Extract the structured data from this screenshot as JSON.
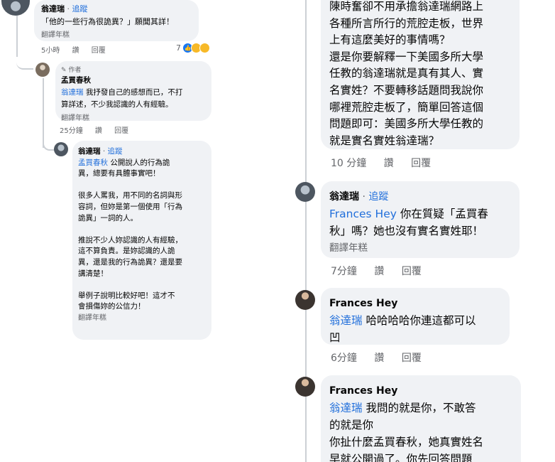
{
  "left": {
    "c1": {
      "author": "翁達瑞",
      "sep": "·",
      "follow": "追蹤",
      "text": "「他的一些行為很詭異？」願聞其詳！",
      "translate": "翻譯年糕",
      "time": "5小時",
      "like": "讚",
      "reply": "回覆",
      "reaction_count": "7",
      "reactions": [
        "like-icon",
        "haha-icon",
        "wow-icon"
      ]
    },
    "c2": {
      "author_badge": "作者",
      "author": "孟買春秋",
      "mention": "翁達瑞",
      "lines": [
        " 我抒發自己的感想而已，不打",
        "算詳述，不少我認識的人有經驗。"
      ],
      "translate": "翻譯年糕",
      "time": "25分鐘",
      "like": "讚",
      "reply": "回覆"
    },
    "c3": {
      "author": "翁達瑞",
      "sep": "·",
      "follow": "追蹤",
      "mention": "孟買春秋",
      "lines": [
        " 公開說人的行為詭",
        "異，總要有具體事實吧！",
        "",
        "很多人罵我，用不同的名詞與形",
        "容詞，但妳是第一個使用「行為",
        "詭異」一詞的人。",
        "",
        "推說不少人妳認識的人有經驗，",
        "這不算負責。是妳認識的人詭",
        "異，還是我的行為詭異？還是要",
        "講清楚！",
        "",
        "舉例子說明比較好吧！這才不",
        "會損傷妳的公信力！"
      ],
      "translate": "翻譯年糕"
    }
  },
  "right": {
    "r0": {
      "lines": [
        "陳時奮卻不用承擔翁達瑞網路上",
        "各種所言所行的荒腔走板，世界",
        "上有這麼美好的事情嗎？",
        "還是你要解釋一下美國多所大學",
        "任教的翁達瑞就是真有其人、實",
        "名實姓？不要轉移話題問我說你",
        "哪裡荒腔走板了，簡單回答這個",
        "問題即可：美國多所大學任教的",
        "就是實名實姓翁達瑞？"
      ],
      "time": "10 分鐘",
      "like": "讚",
      "reply": "回覆"
    },
    "r1": {
      "author": "翁達瑞",
      "sep": "·",
      "follow": "追蹤",
      "mention": "Frances Hey",
      "lines": [
        " 你在質疑「孟買春",
        "秋」嗎？她也沒有實名實姓耶！"
      ],
      "translate": "翻譯年糕",
      "time": "7分鐘",
      "like": "讚",
      "reply": "回覆"
    },
    "r2": {
      "author": "Frances Hey",
      "mention": "翁達瑞",
      "lines": [
        " 哈哈哈哈你連這都可以",
        "凹"
      ],
      "time": "6分鐘",
      "like": "讚",
      "reply": "回覆"
    },
    "r3": {
      "author": "Frances Hey",
      "mention": "翁達瑞",
      "lines": [
        " 我問的就是你，不敢答",
        "的就是你",
        "你扯什麼孟買春秋，她真實姓名",
        "早就公開過了。你先回答問題"
      ]
    }
  }
}
